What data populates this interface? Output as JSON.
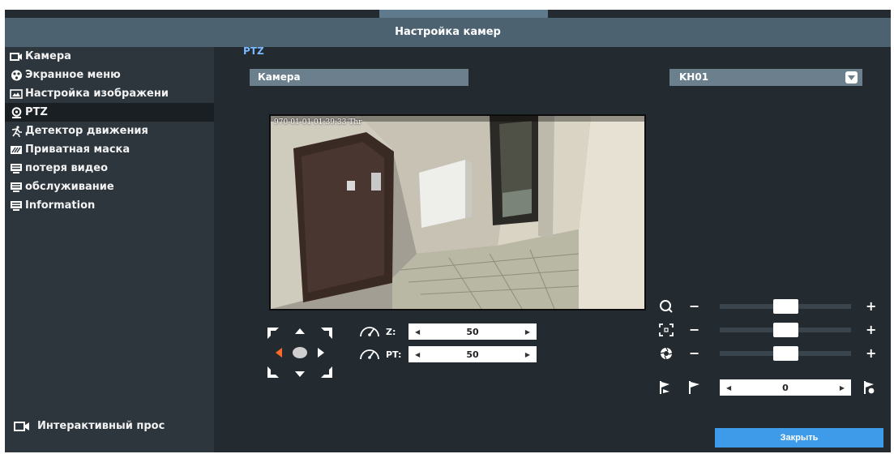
{
  "window": {
    "title": "Настройка камер"
  },
  "sidebar": {
    "items": [
      {
        "label": "Камера",
        "icon": "camera-icon",
        "active": false
      },
      {
        "label": "Экранное меню",
        "icon": "osd-icon",
        "active": false
      },
      {
        "label": "Настройка изображени",
        "icon": "image-settings-icon",
        "active": false
      },
      {
        "label": "PTZ",
        "icon": "ptz-icon",
        "active": true
      },
      {
        "label": "Детектор движения",
        "icon": "motion-icon",
        "active": false
      },
      {
        "label": "Приватная маска",
        "icon": "privacy-mask-icon",
        "active": false
      },
      {
        "label": "потеря видео",
        "icon": "monitor-icon",
        "active": false
      },
      {
        "label": "обслуживание",
        "icon": "monitor-icon",
        "active": false
      },
      {
        "label": "Information",
        "icon": "monitor-icon",
        "active": false
      }
    ],
    "live_view_label": "Интерактивный прос"
  },
  "main": {
    "section_title": "PTZ",
    "camera_label": "Камера",
    "camera_select": {
      "value": "KH01",
      "icon": "chevron-down-icon"
    },
    "video": {
      "osd_timestamp": "970-01-01 01:39:33 Thr"
    },
    "zoom": {
      "label": "Z:",
      "value": "50"
    },
    "pan_tilt": {
      "label": "PT:",
      "value": "50"
    },
    "sliders": [
      {
        "name": "zoom",
        "icon": "zoom-icon",
        "level": 0.5
      },
      {
        "name": "focus",
        "icon": "focus-icon",
        "level": 0.5
      },
      {
        "name": "iris",
        "icon": "iris-icon",
        "level": 0.5
      }
    ],
    "preset": {
      "value": "0"
    },
    "close_label": "Закрыть"
  },
  "colors": {
    "titlebar": "#4c6270",
    "panel": "#232a30",
    "sidebar": "#2d363d",
    "accent": "#3d9be9",
    "section_title": "#7ab8ff",
    "dpad_active": "#ff6a2b"
  }
}
